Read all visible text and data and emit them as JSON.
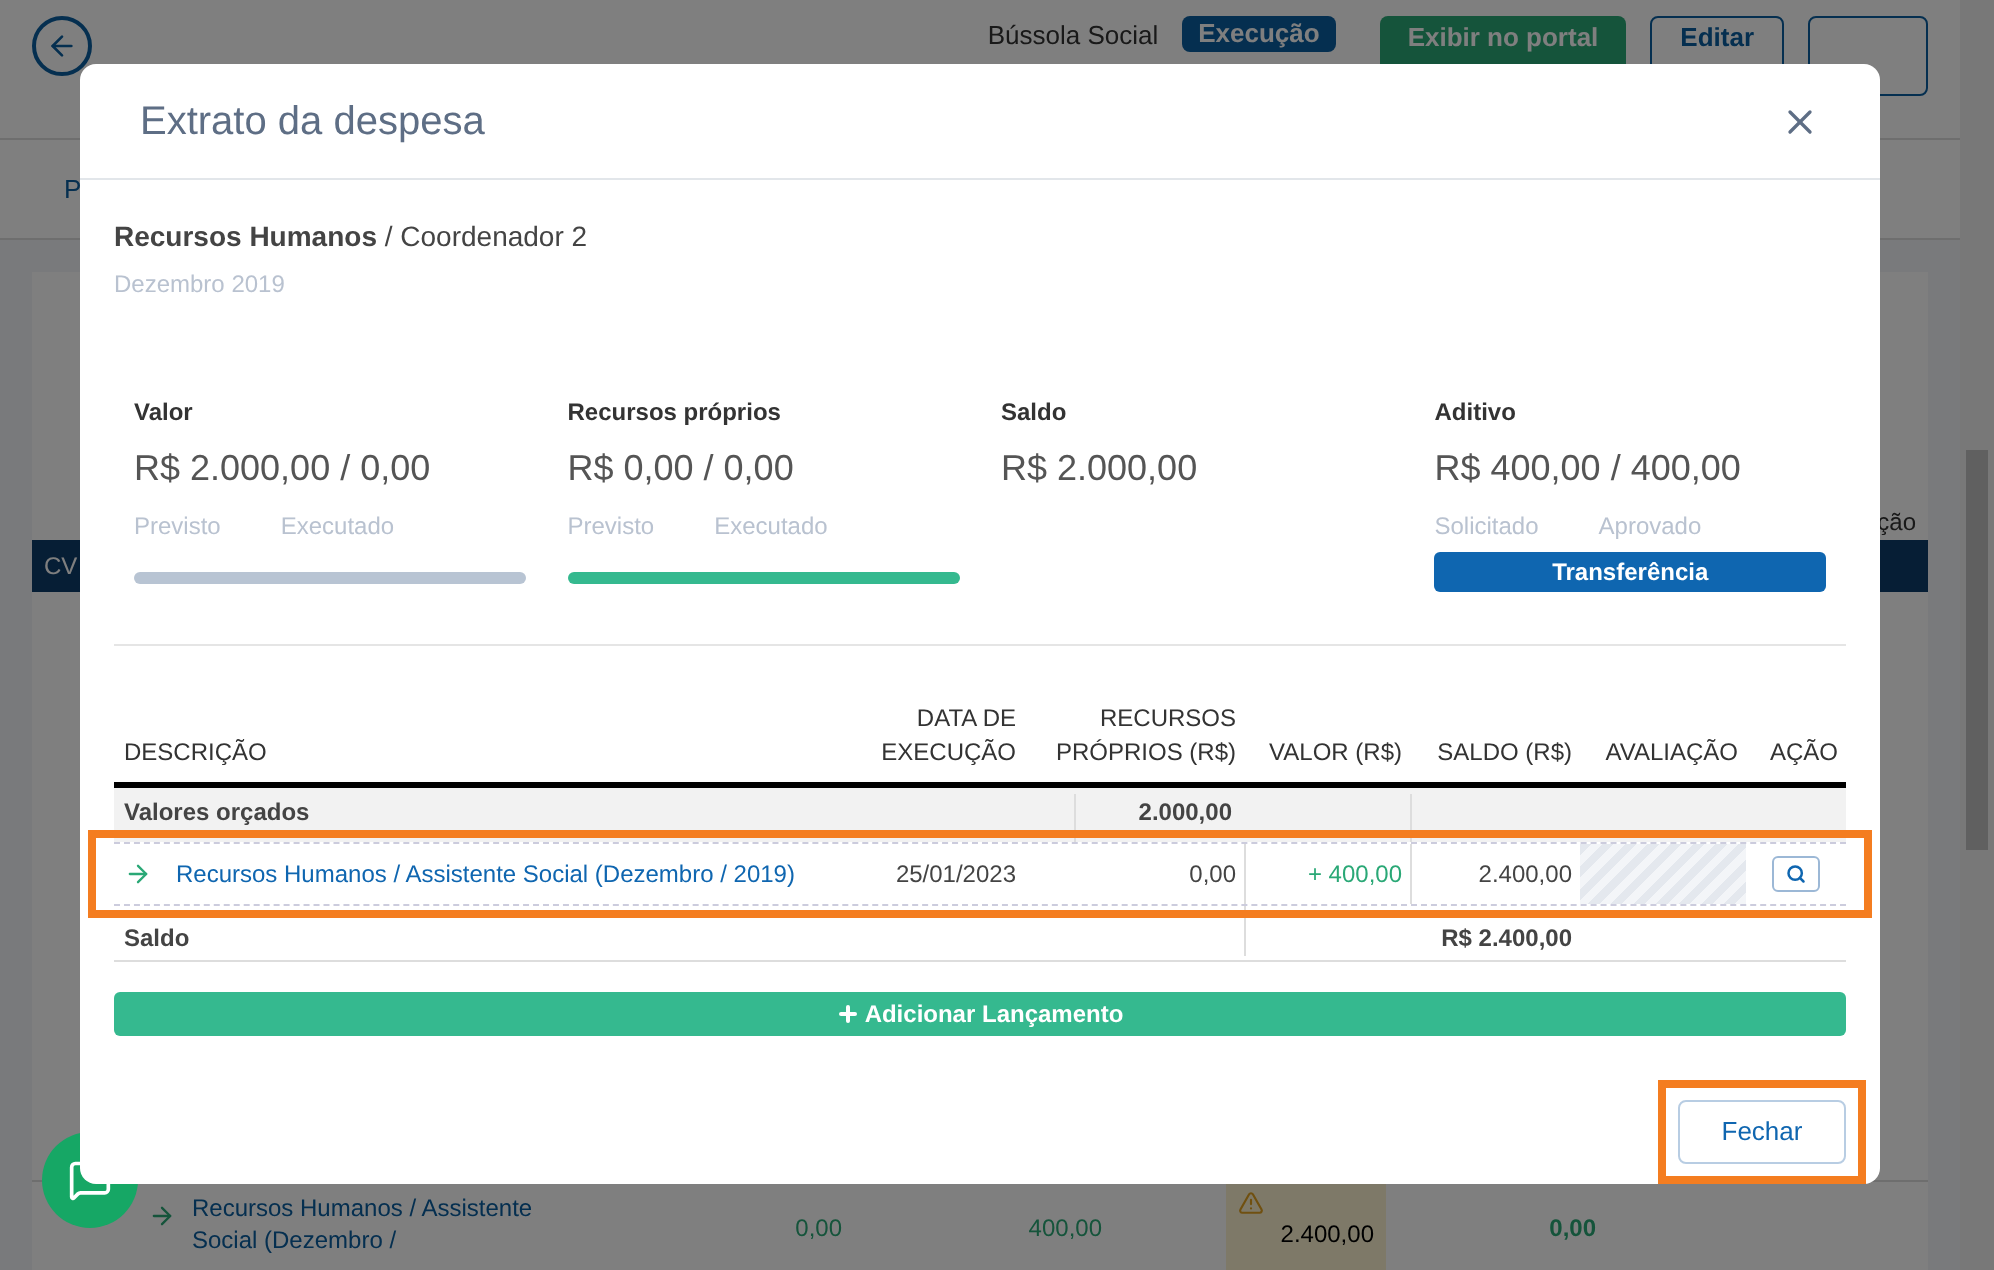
{
  "background": {
    "brand": "Bússola Social",
    "status_badge": "Execução",
    "portal_button": "Exibir no portal",
    "edit_button": "Editar",
    "tab_fragment": "P",
    "column_fragment": "CV",
    "header_fragment": "ção",
    "row": {
      "description": "Recursos Humanos / Assistente Social (Dezembro /",
      "own": "0,00",
      "value": "400,00",
      "balance": "2.400,00",
      "evaluation": "0,00",
      "warning": true
    }
  },
  "modal": {
    "title": "Extrato da despesa",
    "heading_bold": "Recursos Humanos",
    "heading_rest": " / Coordenador 2",
    "period": "Dezembro 2019",
    "stats": [
      {
        "kind": "bar",
        "label": "Valor",
        "amount": "R$ 2.000,00 / 0,00",
        "sub": [
          "Previsto",
          "Executado"
        ],
        "color": "#b8c4d3"
      },
      {
        "kind": "bar",
        "label": "Recursos próprios",
        "amount": "R$ 0,00 / 0,00",
        "sub": [
          "Previsto",
          "Executado"
        ],
        "color": "#35b98f"
      },
      {
        "kind": "plain",
        "label": "Saldo",
        "amount": "R$ 2.000,00"
      },
      {
        "kind": "action",
        "label": "Aditivo",
        "amount": "R$ 400,00 / 400,00",
        "sub": [
          "Solicitado",
          "Aprovado"
        ],
        "button": "Transferência"
      }
    ],
    "table": {
      "columns": [
        [
          "DESCRIÇÃO"
        ],
        [
          "DATA DE",
          "EXECUÇÃO"
        ],
        [
          "RECURSOS",
          "PRÓPRIOS (R$)"
        ],
        [
          "VALOR (R$)"
        ],
        [
          "SALDO (R$)"
        ],
        [
          "AVALIAÇÃO"
        ],
        [
          "AÇÃO"
        ]
      ],
      "budget_row": {
        "label": "Valores orçados",
        "value": "2.000,00"
      },
      "rows": [
        {
          "description": "Recursos Humanos / Assistente Social (Dezembro / 2019)",
          "date": "25/01/2023",
          "own": "0,00",
          "value": "+ 400,00",
          "balance": "2.400,00",
          "highlighted": true
        }
      ],
      "total_row": {
        "label": "Saldo",
        "balance": "R$ 2.400,00"
      }
    },
    "add_button": "Adicionar Lançamento",
    "close_button": {
      "label": "Fechar",
      "highlighted": true
    }
  }
}
